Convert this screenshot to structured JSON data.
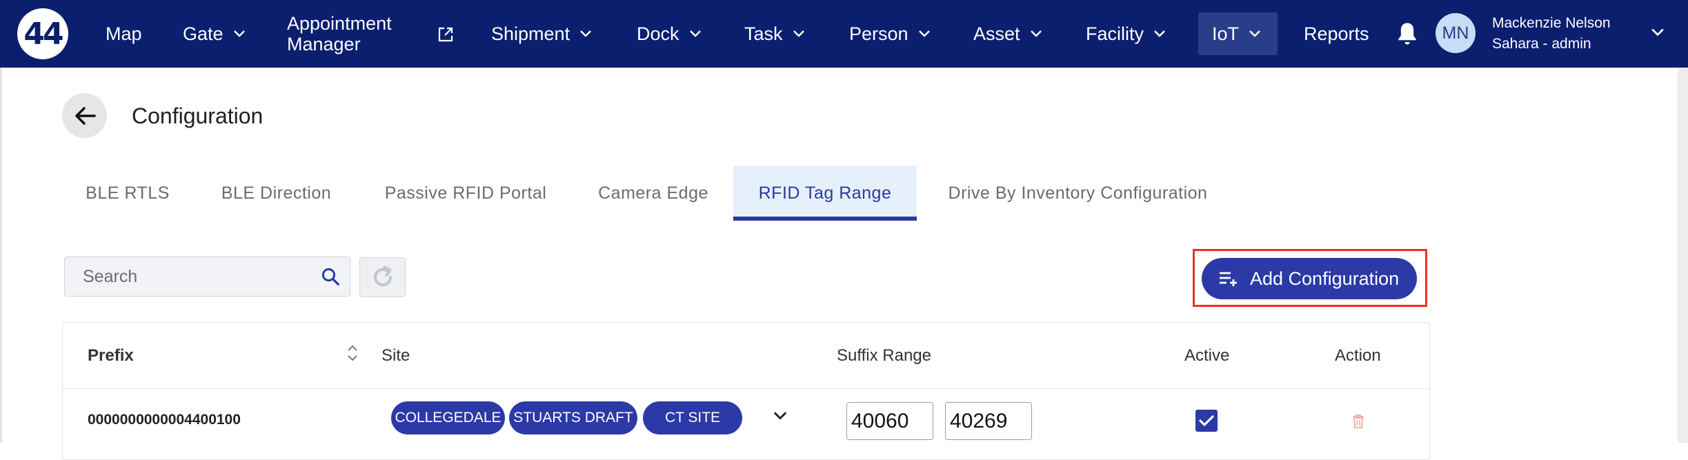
{
  "nav": {
    "logo_text": "44",
    "items": [
      {
        "label": "Map"
      },
      {
        "label": "Gate"
      },
      {
        "label_line1": "Appointment",
        "label_line2": "Manager"
      },
      {
        "label": "Shipment"
      },
      {
        "label": "Dock"
      },
      {
        "label": "Task"
      },
      {
        "label": "Person"
      },
      {
        "label": "Asset"
      },
      {
        "label": "Facility"
      },
      {
        "label": "IoT"
      },
      {
        "label": "Reports"
      }
    ],
    "active_item": "IoT",
    "user": {
      "initials": "MN",
      "name": "Mackenzie Nelson",
      "role": "Sahara - admin"
    },
    "icons": [
      "external-link-icon",
      "chevron-down-icon",
      "bell-icon"
    ]
  },
  "header": {
    "title": "Configuration"
  },
  "tabs": [
    {
      "label": "BLE RTLS"
    },
    {
      "label": "BLE Direction"
    },
    {
      "label": "Passive RFID Portal"
    },
    {
      "label": "Camera Edge"
    },
    {
      "label": "RFID Tag Range"
    },
    {
      "label": "Drive By Inventory Configuration"
    }
  ],
  "active_tab": "RFID Tag Range",
  "toolbar": {
    "search_placeholder": "Search",
    "add_label": "Add Configuration"
  },
  "table": {
    "columns": [
      "Prefix",
      "Site",
      "Suffix Range",
      "Active",
      "Action"
    ],
    "rows": [
      {
        "prefix": "0000000000004400100",
        "sites": [
          "COLLEGEDALE",
          "STUARTS DRAFT",
          "CT SITE"
        ],
        "suffix_from": "40060",
        "suffix_to": "40269",
        "active": true
      }
    ]
  },
  "colors": {
    "nav_bg": "#0b1f6e",
    "accent": "#2b3aa6",
    "highlight_outline": "#e8321f",
    "active_tab_bg": "#e6f0fa"
  }
}
